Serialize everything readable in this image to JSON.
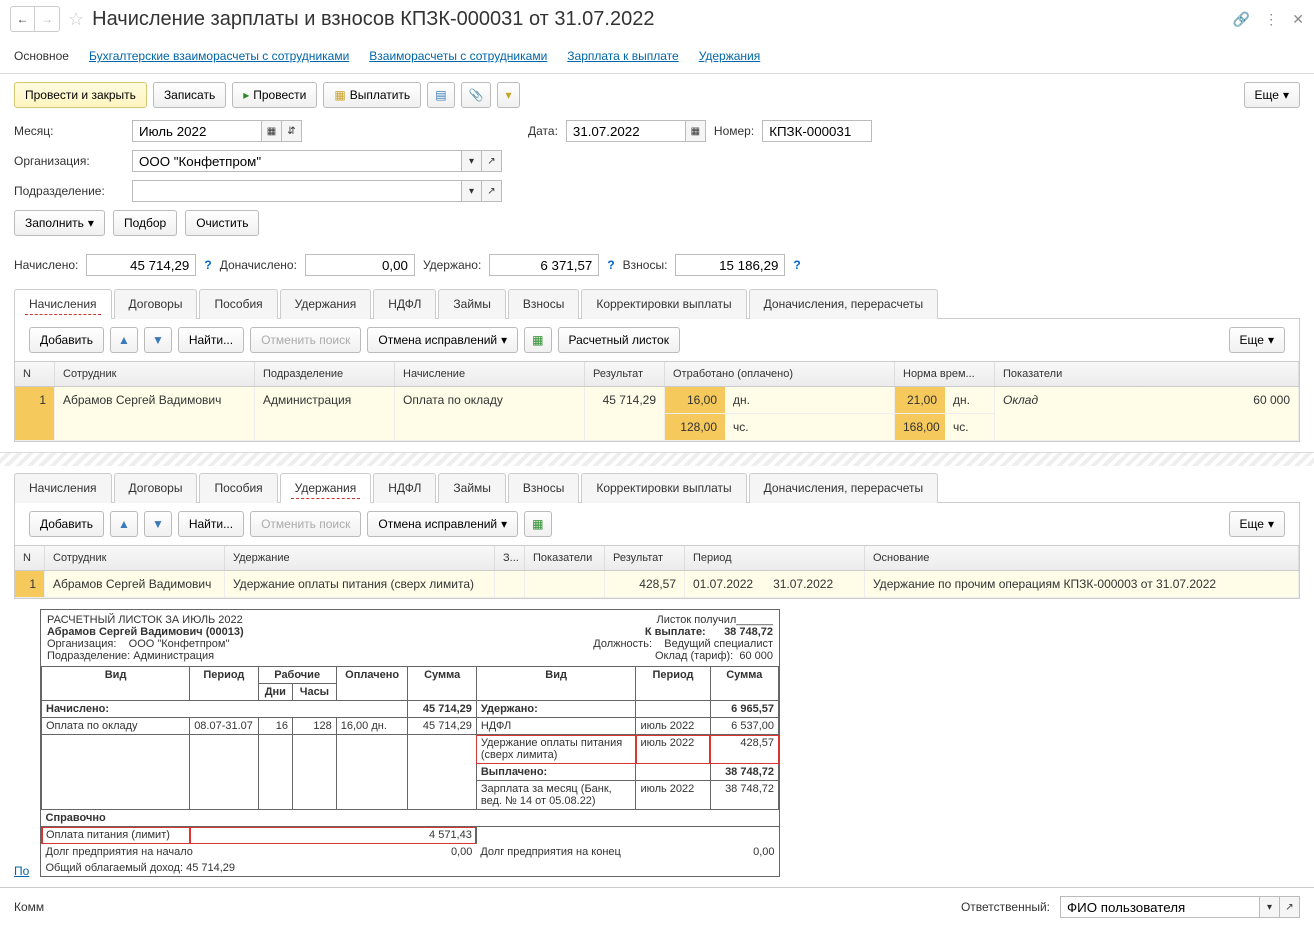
{
  "title": "Начисление зарплаты и взносов КПЗК-000031 от 31.07.2022",
  "nav": {
    "main": "Основное",
    "links": [
      "Бухгалтерские взаиморасчеты с сотрудниками",
      "Взаиморасчеты с сотрудниками",
      "Зарплата к выплате",
      "Удержания"
    ]
  },
  "toolbar": {
    "post_close": "Провести и закрыть",
    "save": "Записать",
    "post": "Провести",
    "pay": "Выплатить",
    "more": "Еще"
  },
  "form": {
    "month_label": "Месяц:",
    "month_value": "Июль 2022",
    "date_label": "Дата:",
    "date_value": "31.07.2022",
    "number_label": "Номер:",
    "number_value": "КПЗК-000031",
    "org_label": "Организация:",
    "org_value": "ООО \"Конфетпром\"",
    "dept_label": "Подразделение:",
    "dept_value": "",
    "fill": "Заполнить",
    "pick": "Подбор",
    "clear": "Очистить"
  },
  "totals": {
    "accrued_label": "Начислено:",
    "accrued": "45 714,29",
    "extra_label": "Доначислено:",
    "extra": "0,00",
    "withheld_label": "Удержано:",
    "withheld": "6 371,57",
    "contrib_label": "Взносы:",
    "contrib": "15 186,29"
  },
  "tabs1": [
    "Начисления",
    "Договоры",
    "Пособия",
    "Удержания",
    "НДФЛ",
    "Займы",
    "Взносы",
    "Корректировки выплаты",
    "Доначисления, перерасчеты"
  ],
  "subtoolbar": {
    "add": "Добавить",
    "find": "Найти...",
    "cancel_search": "Отменить поиск",
    "cancel_fix": "Отмена исправлений",
    "payslip": "Расчетный листок",
    "more": "Еще"
  },
  "grid1": {
    "headers": {
      "n": "N",
      "emp": "Сотрудник",
      "dept": "Подразделение",
      "accr": "Начисление",
      "res": "Результат",
      "worked": "Отработано (оплачено)",
      "norm": "Норма врем...",
      "ind": "Показатели"
    },
    "row": {
      "n": "1",
      "emp": "Абрамов Сергей Вадимович",
      "dept": "Администрация",
      "accr": "Оплата по окладу",
      "res": "45 714,29",
      "days": "16,00",
      "days_u": "дн.",
      "hours": "128,00",
      "hours_u": "чс.",
      "ndays": "21,00",
      "ndays_u": "дн.",
      "nhours": "168,00",
      "nhours_u": "чс.",
      "ind": "Оклад",
      "ind_val": "60 000"
    }
  },
  "tabs2_active": "Удержания",
  "grid2": {
    "headers": {
      "n": "N",
      "emp": "Сотрудник",
      "ded": "Удержание",
      "z": "З...",
      "ind": "Показатели",
      "res": "Результат",
      "period": "Период",
      "basis": "Основание"
    },
    "row": {
      "n": "1",
      "emp": "Абрамов Сергей Вадимович",
      "ded": "Удержание оплаты питания (сверх лимита)",
      "res": "428,57",
      "p1": "01.07.2022",
      "p2": "31.07.2022",
      "basis": "Удержание по прочим операциям КПЗК-000003 от 31.07.2022"
    }
  },
  "payslip": {
    "title": "РАСЧЕТНЫЙ ЛИСТОК ЗА ИЮЛЬ 2022",
    "received": "Листок получил______",
    "emp": "Абрамов Сергей Вадимович (00013)",
    "to_pay_label": "К выплате:",
    "to_pay": "38 748,72",
    "org_label": "Организация:",
    "org": "ООО \"Конфетпром\"",
    "pos_label": "Должность:",
    "pos": "Ведущий специалист",
    "dept_label": "Подразделение:",
    "dept": "Администрация",
    "rate_label": "Оклад (тариф):",
    "rate": "60 000",
    "h_vid": "Вид",
    "h_period": "Период",
    "h_work": "Рабочие",
    "h_paid": "Оплачено",
    "h_sum": "Сумма",
    "h_days": "Дни",
    "h_hours": "Часы",
    "accrued": "Начислено:",
    "accrued_sum": "45 714,29",
    "salary": "Оплата по окладу",
    "sal_period": "08.07-31.07",
    "sal_days": "16",
    "sal_hours": "128",
    "sal_paid": "16,00 дн.",
    "sal_sum": "45 714,29",
    "withheld": "Удержано:",
    "withheld_sum": "6 965,57",
    "ndfl": "НДФЛ",
    "ndfl_period": "июль 2022",
    "ndfl_sum": "6 537,00",
    "meal": "Удержание оплаты питания (сверх лимита)",
    "meal_period": "июль 2022",
    "meal_sum": "428,57",
    "paid": "Выплачено:",
    "paid_sum": "38 748,72",
    "zp": "Зарплата за месяц (Банк, вед. № 14 от 05.08.22)",
    "zp_period": "июль 2022",
    "zp_sum": "38 748,72",
    "ref": "Справочно",
    "meal_lim": "Оплата питания (лимит)",
    "meal_lim_sum": "4 571,43",
    "debt_start": "Долг предприятия на начало",
    "debt_start_sum": "0,00",
    "debt_end": "Долг предприятия на конец",
    "debt_end_sum": "0,00",
    "taxable": "Общий облагаемый доход: 45 714,29"
  },
  "footer": {
    "comm": "Комм",
    "resp_label": "Ответственный:",
    "resp_value": "ФИО пользователя",
    "link": "По"
  }
}
